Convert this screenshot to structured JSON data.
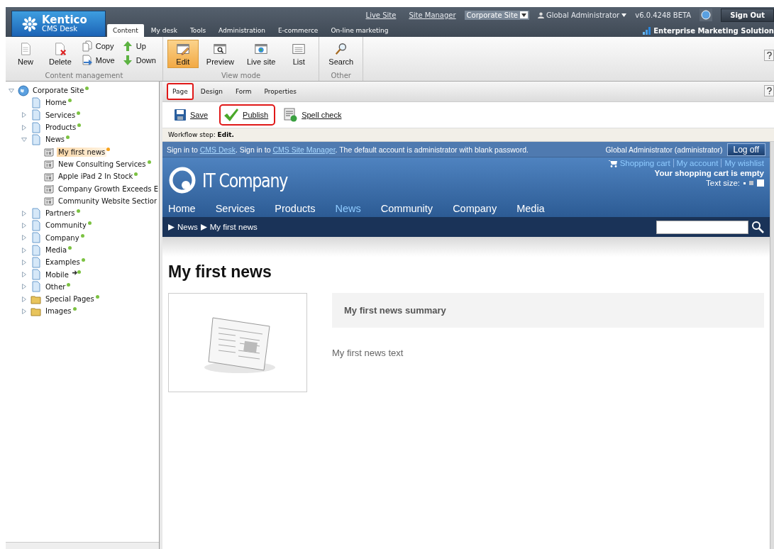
{
  "header": {
    "logo": {
      "name": "Kentico",
      "product": "CMS Desk"
    },
    "links": [
      {
        "label": "Live Site"
      },
      {
        "label": "Site Manager"
      }
    ],
    "site_select": {
      "value": "Corporate Site"
    },
    "user": "Global Administrator",
    "version": "v6.0.4248 BETA",
    "sign_out": "Sign Out",
    "edition": "Enterprise Marketing Solution",
    "tabs": [
      {
        "label": "Content",
        "selected": true
      },
      {
        "label": "My desk",
        "selected": false
      },
      {
        "label": "Tools",
        "selected": false
      },
      {
        "label": "Administration",
        "selected": false
      },
      {
        "label": "E-commerce",
        "selected": false
      },
      {
        "label": "On-line marketing",
        "selected": false
      }
    ]
  },
  "ribbon": [
    {
      "title": "Content management",
      "buttons": [
        {
          "label": "New",
          "kind": "large"
        },
        {
          "label": "Delete",
          "kind": "large"
        },
        {
          "label": "Copy",
          "kind": "small"
        },
        {
          "label": "Move",
          "kind": "small"
        },
        {
          "label": "Up",
          "kind": "small"
        },
        {
          "label": "Down",
          "kind": "small"
        }
      ]
    },
    {
      "title": "View mode",
      "buttons": [
        {
          "label": "Edit",
          "kind": "large",
          "selected": true
        },
        {
          "label": "Preview",
          "kind": "large",
          "selected": false
        },
        {
          "label": "Live site",
          "kind": "large",
          "selected": false
        },
        {
          "label": "List",
          "kind": "large",
          "selected": false
        }
      ]
    },
    {
      "title": "Other",
      "buttons": [
        {
          "label": "Search",
          "kind": "large"
        }
      ]
    }
  ],
  "tree": {
    "label": "Corporate Site",
    "kind": "site",
    "expanded": true,
    "color": "#7cc242",
    "children": [
      {
        "label": "Home",
        "kind": "page",
        "color": "#7cc242"
      },
      {
        "label": "Services",
        "kind": "page",
        "expanded": false,
        "color": "#7cc242"
      },
      {
        "label": "Products",
        "kind": "page",
        "expanded": false,
        "color": "#7cc242"
      },
      {
        "label": "News",
        "kind": "page",
        "expanded": true,
        "color": "#7cc242",
        "children": [
          {
            "label": "My first news",
            "kind": "news",
            "selected": true,
            "color": "#f7a21c"
          },
          {
            "label": "New Consulting Services",
            "kind": "news",
            "selected": false,
            "color": "#7cc242"
          },
          {
            "label": "Apple iPad 2 In Stock",
            "kind": "news",
            "selected": false,
            "color": "#7cc242"
          },
          {
            "label": "Company Growth Exceeds E",
            "kind": "news",
            "selected": false
          },
          {
            "label": "Community Website Sectior",
            "kind": "news",
            "selected": false
          }
        ]
      },
      {
        "label": "Partners",
        "kind": "page",
        "expanded": false,
        "color": "#7cc242"
      },
      {
        "label": "Community",
        "kind": "page",
        "expanded": false,
        "color": "#7cc242"
      },
      {
        "label": "Company",
        "kind": "page",
        "expanded": false,
        "color": "#7cc242"
      },
      {
        "label": "Media",
        "kind": "page",
        "expanded": false,
        "color": "#7cc242"
      },
      {
        "label": "Examples",
        "kind": "page",
        "expanded": false,
        "color": "#7cc242"
      },
      {
        "label": "Mobile",
        "kind": "page",
        "expanded": false,
        "linked": true,
        "color": "#7cc242"
      },
      {
        "label": "Other",
        "kind": "page",
        "expanded": false,
        "color": "#7cc242"
      },
      {
        "label": "Special Pages",
        "kind": "folder",
        "expanded": false,
        "color": "#7cc242"
      },
      {
        "label": "Images",
        "kind": "folder",
        "expanded": false,
        "color": "#7cc242"
      }
    ]
  },
  "page_tabs": [
    {
      "label": "Page",
      "selected": true,
      "highlighted": true
    },
    {
      "label": "Design",
      "selected": false,
      "highlighted": false
    },
    {
      "label": "Form",
      "selected": false,
      "highlighted": false
    },
    {
      "label": "Properties",
      "selected": false,
      "highlighted": false
    }
  ],
  "actions": [
    {
      "label": "Save",
      "highlighted": false
    },
    {
      "label": "Publish",
      "highlighted": true
    },
    {
      "label": "Spell check",
      "highlighted": false
    }
  ],
  "workflow": {
    "label": "Workflow step:",
    "step": "Edit."
  },
  "site": {
    "signin": [
      "Sign in to ",
      "CMS Desk",
      ". Sign in to ",
      "CMS Site Manager",
      ". The default account is administrator with blank password."
    ],
    "user": "Global Administrator (administrator)",
    "logoff": "Log off",
    "logo": "IT Company",
    "cart_links": [
      {
        "label": "Shopping cart"
      },
      {
        "label": "My account"
      },
      {
        "label": "My wishlist"
      }
    ],
    "cart_status": "Your shopping cart is empty",
    "text_size": "Text size:",
    "text_sizes": [
      {
        "selected": false
      },
      {
        "selected": true
      },
      {
        "selected": false
      }
    ],
    "nav": [
      {
        "label": "Home",
        "selected": false
      },
      {
        "label": "Services",
        "selected": false
      },
      {
        "label": "Products",
        "selected": false
      },
      {
        "label": "News",
        "selected": true
      },
      {
        "label": "Community",
        "selected": false
      },
      {
        "label": "Company",
        "selected": false
      },
      {
        "label": "Media",
        "selected": false
      }
    ],
    "breadcrumb": [
      "News",
      "My first news"
    ],
    "title": "My first news",
    "summary": "My first news summary",
    "text": "My first news text"
  }
}
